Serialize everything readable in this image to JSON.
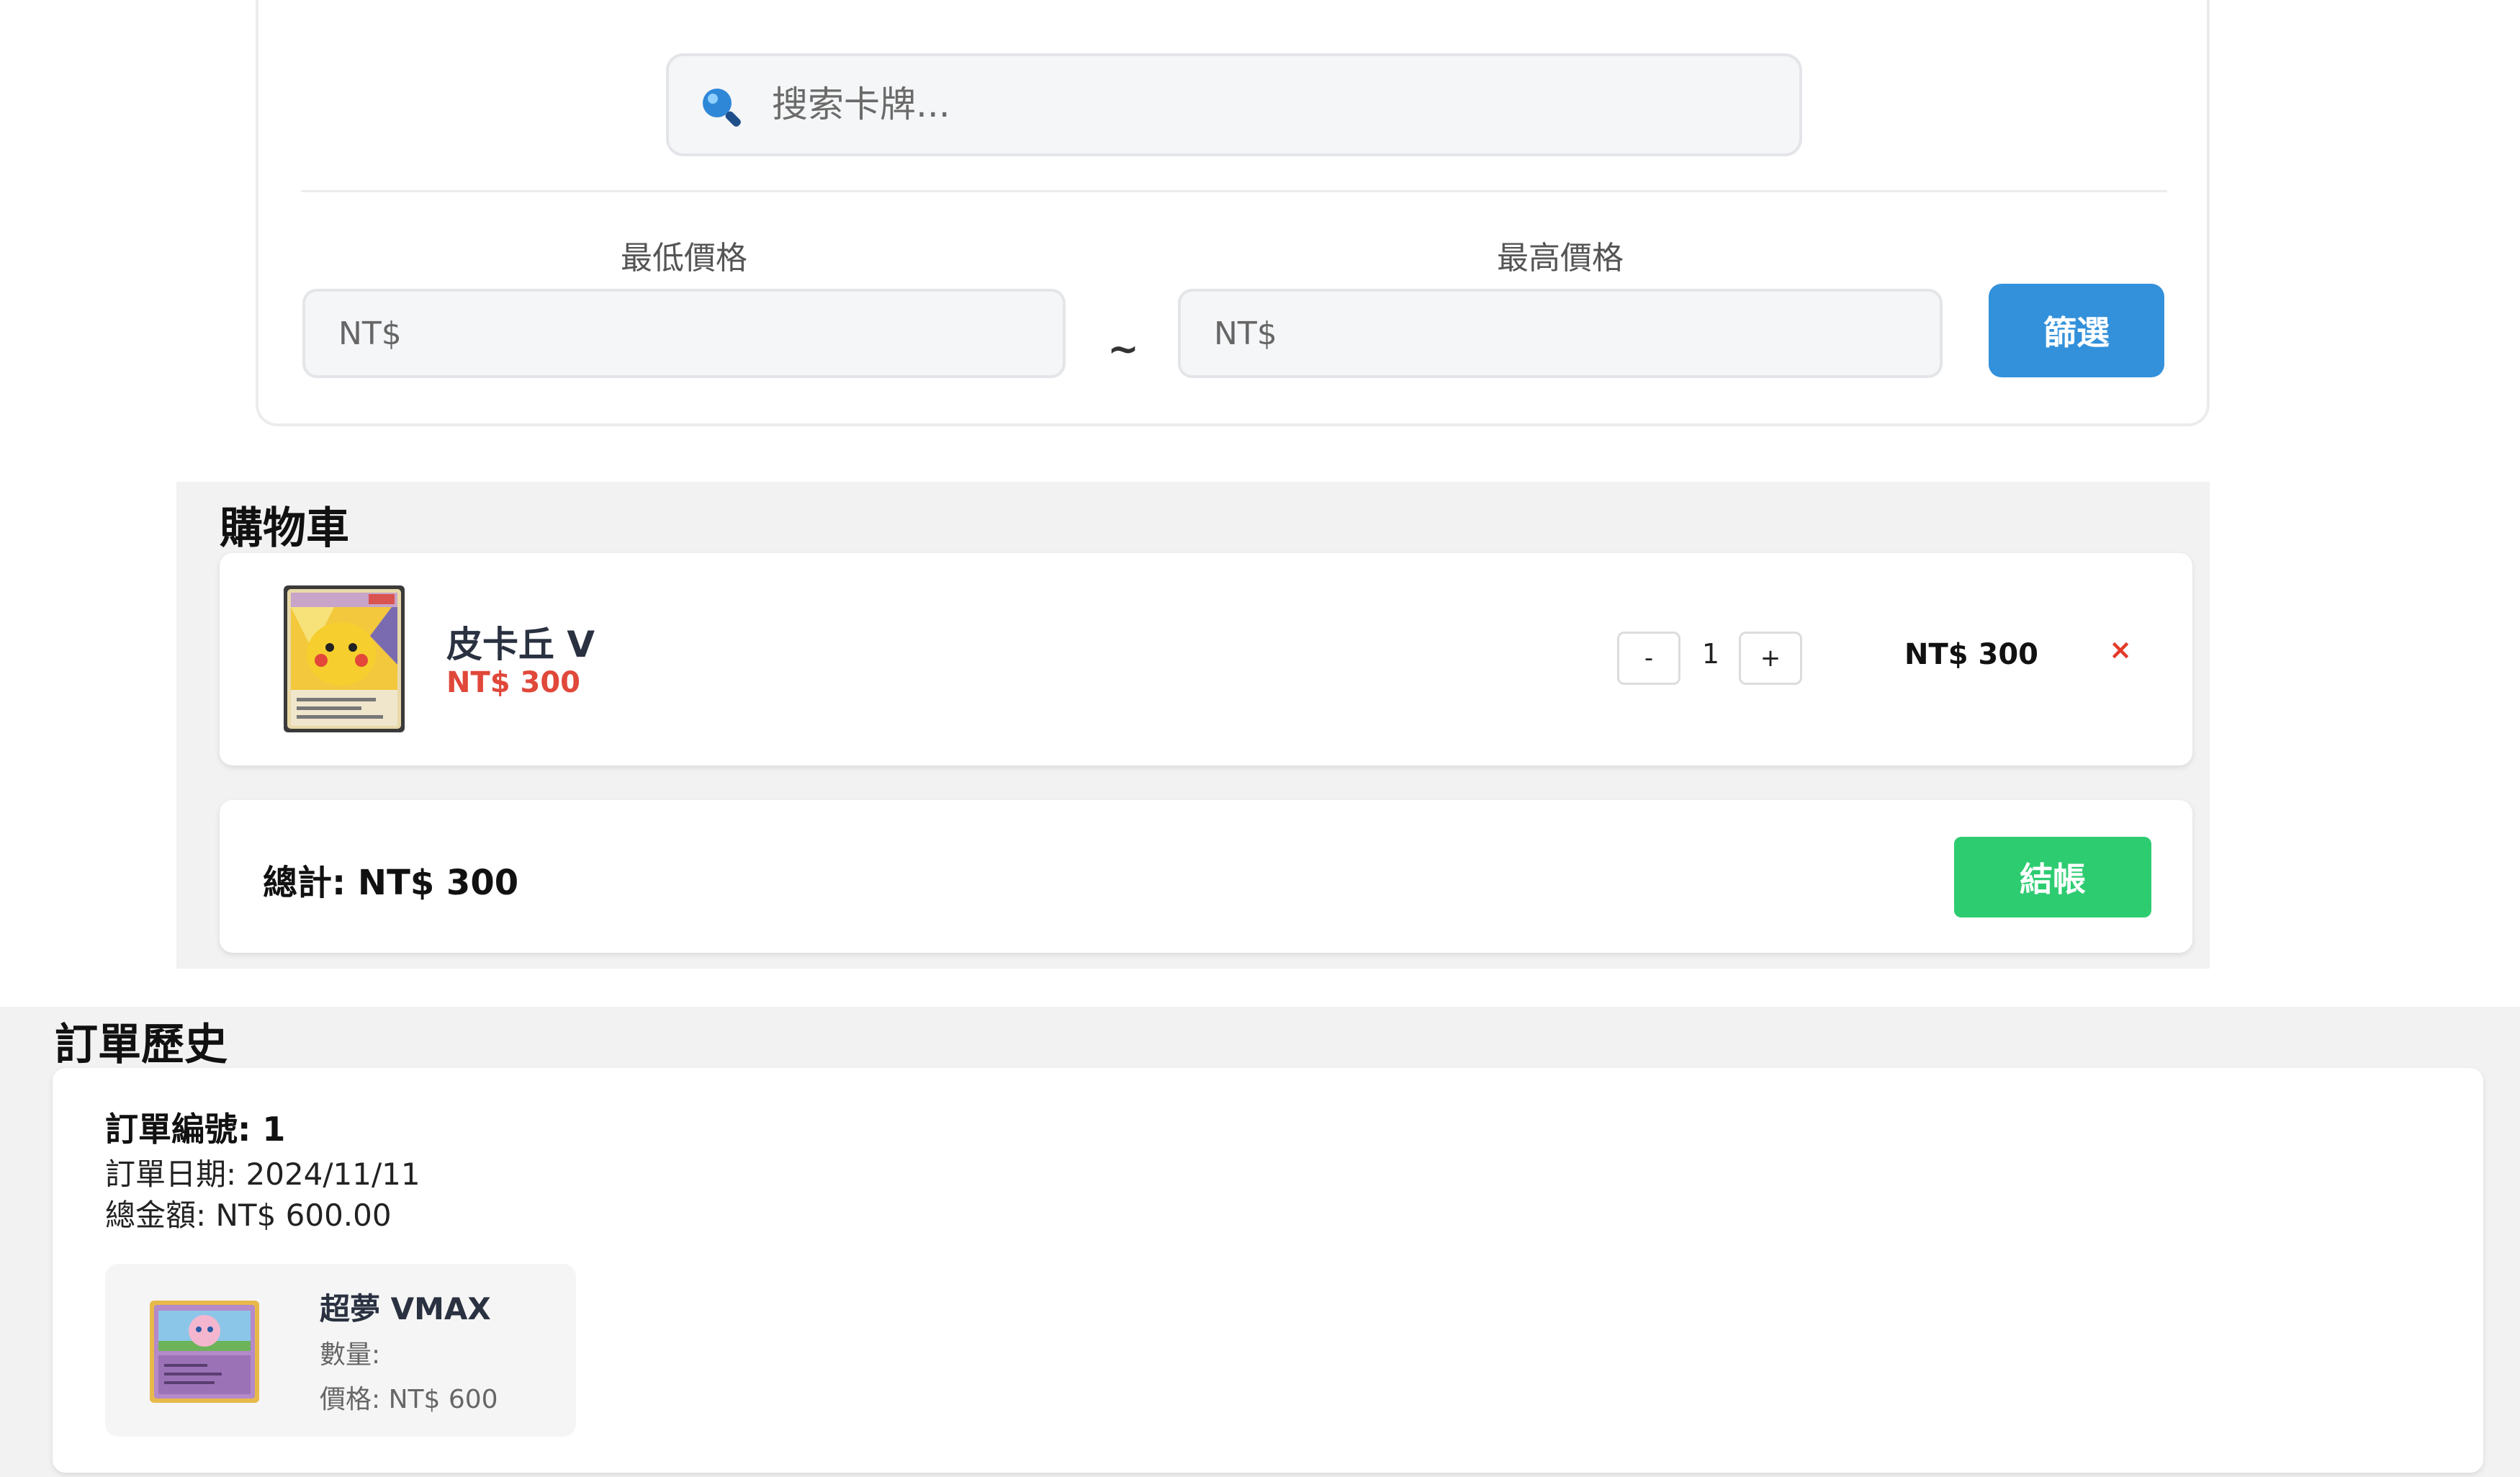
{
  "search": {
    "placeholder": "搜索卡牌..."
  },
  "filter": {
    "min_label": "最低價格",
    "max_label": "最高價格",
    "min_placeholder": "NT$",
    "max_placeholder": "NT$",
    "separator": "~",
    "button_label": "篩選"
  },
  "cart": {
    "title": "購物車",
    "items": [
      {
        "name": "皮卡丘 V",
        "price": "NT$ 300",
        "quantity": "1",
        "minus_label": "-",
        "plus_label": "+",
        "subtotal": "NT$ 300",
        "remove_label": "×",
        "image_icon": "pikachu-v-card-icon"
      }
    ],
    "total": "總計: NT$ 300",
    "checkout_label": "結帳"
  },
  "history": {
    "title": "訂單歷史",
    "orders": [
      {
        "number": "訂單編號: 1",
        "date": "訂單日期: 2024/11/11",
        "total": "總金額: NT$ 600.00",
        "items": [
          {
            "name": "超夢 VMAX",
            "quantity": "數量:",
            "price": "價格: NT$ 600",
            "image_icon": "jigglypuff-card-icon"
          }
        ]
      }
    ]
  },
  "colors": {
    "filter_button": "#3391db",
    "checkout_button": "#2ecc71",
    "price_red": "#e0483a",
    "remove_red": "#e23a2a"
  }
}
